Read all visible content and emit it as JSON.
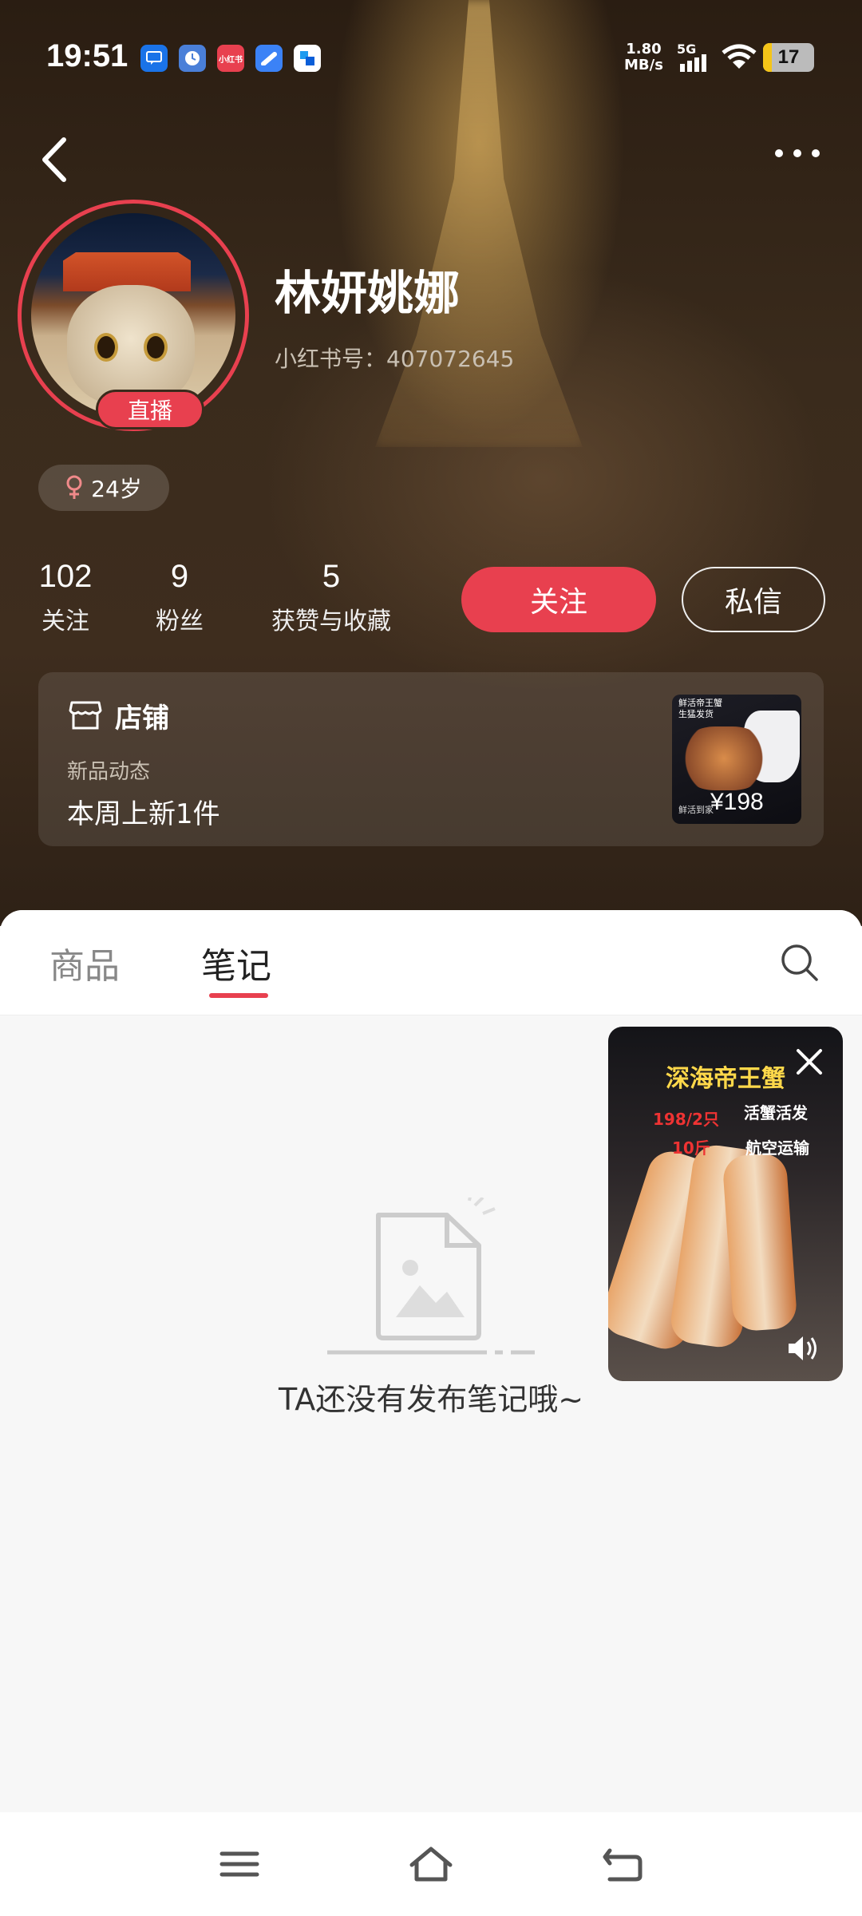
{
  "status_bar": {
    "time": "19:51",
    "app_icons": [
      {
        "name": "chat-icon",
        "color": "#1a73e8",
        "label": ""
      },
      {
        "name": "clock-icon",
        "color": "#4a7fd8",
        "label": ""
      },
      {
        "name": "xiaohongshu-icon",
        "color": "#e8404f",
        "label": "小红书"
      },
      {
        "name": "cloud-icon",
        "color": "#3b82f6",
        "label": ""
      },
      {
        "name": "app-icon",
        "color": "#1d9bf0",
        "label": ""
      }
    ],
    "net_speed_value": "1.80",
    "net_speed_unit": "MB/s",
    "signal_label": "5G",
    "battery_level": "17"
  },
  "profile": {
    "name": "林妍姚娜",
    "red_id_label": "小红书号：407072645",
    "live_label": "直播",
    "age_label": "24岁",
    "stats": [
      {
        "value": "102",
        "label": "关注"
      },
      {
        "value": "9",
        "label": "粉丝"
      },
      {
        "value": "5",
        "label": "获赞与收藏"
      }
    ],
    "follow_label": "关注",
    "message_label": "私信"
  },
  "shop": {
    "title": "店铺",
    "subtitle": "新品动态",
    "update_text": "本周上新1件",
    "thumb_line1": "鲜活帝王蟹",
    "thumb_line2": "生猛发货",
    "thumb_caption": "鲜活到家",
    "thumb_price": "¥198"
  },
  "tabs": {
    "items": [
      "商品",
      "笔记"
    ],
    "active": "笔记"
  },
  "empty_state": {
    "message": "TA还没有发布笔记哦~"
  },
  "floating_video": {
    "headline": "深海帝王蟹",
    "price_text": "198/2只",
    "weight_text": "10斤",
    "tag1": "活蟹活发",
    "tag2": "航空运输"
  },
  "colors": {
    "accent": "#e8404f",
    "hero_bg": "#3a2b1c",
    "sheet_bg": "#f7f7f7"
  }
}
